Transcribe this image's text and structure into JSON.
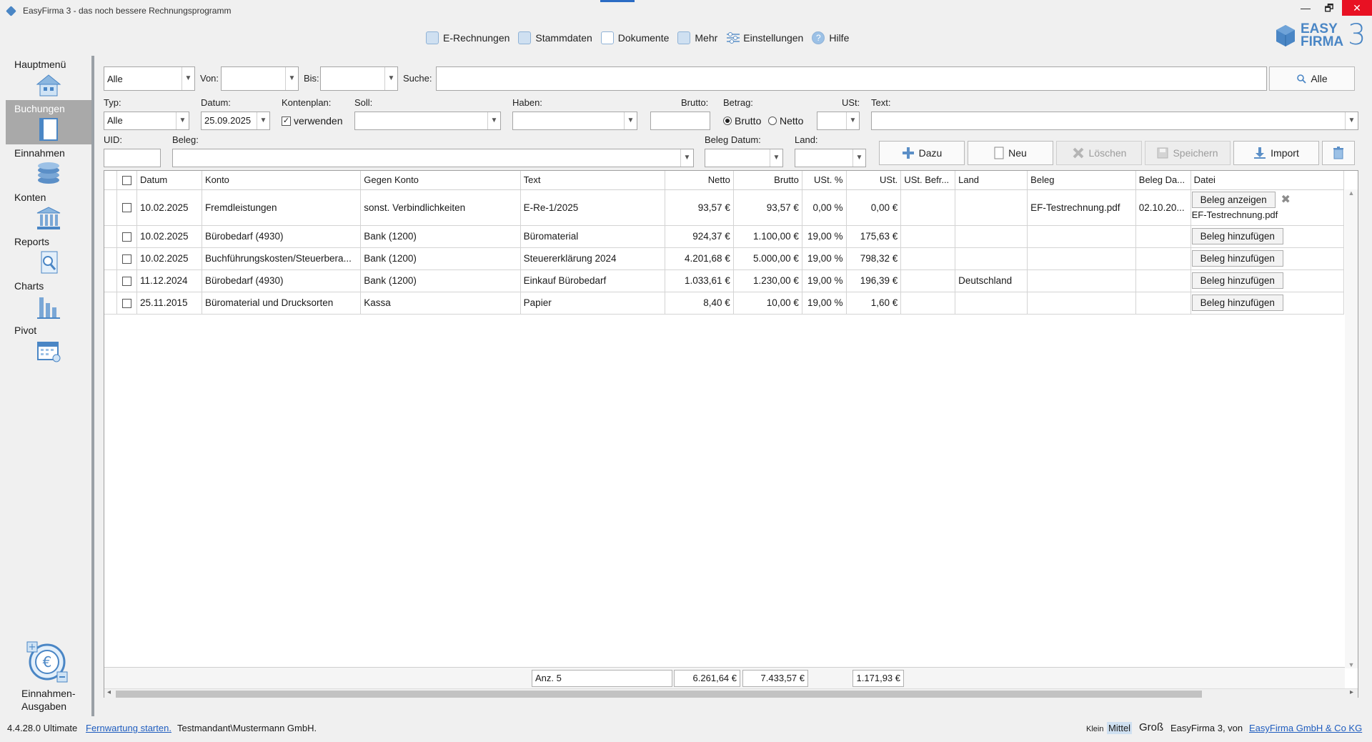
{
  "window": {
    "title": "EasyFirma 3 - das noch bessere Rechnungsprogramm",
    "minimize": "—",
    "restore": "🗗",
    "close": "✕"
  },
  "topnav": [
    {
      "label": "E-Rechnungen",
      "icon": "e-invoice-icon"
    },
    {
      "label": "Stammdaten",
      "icon": "master-data-icon"
    },
    {
      "label": "Dokumente",
      "icon": "documents-icon"
    },
    {
      "label": "Mehr",
      "icon": "more-icon"
    },
    {
      "label": "Einstellungen",
      "icon": "settings-icon"
    },
    {
      "label": "Hilfe",
      "icon": "help-icon"
    }
  ],
  "logo": {
    "line1": "EASY",
    "line2": "FIRMA",
    "number": "3"
  },
  "sidebar": {
    "items": [
      {
        "label": "Hauptmenü",
        "icon": "home-icon"
      },
      {
        "label": "Buchungen",
        "icon": "book-icon"
      },
      {
        "label": "Einnahmen",
        "icon": "coins-icon"
      },
      {
        "label": "Konten",
        "icon": "bank-icon"
      },
      {
        "label": "Reports",
        "icon": "report-search-icon"
      },
      {
        "label": "Charts",
        "icon": "bar-chart-icon"
      },
      {
        "label": "Pivot",
        "icon": "calendar-icon"
      }
    ],
    "bottom_label_1": "Einnahmen-",
    "bottom_label_2": "Ausgaben"
  },
  "filter": {
    "range_value": "Alle",
    "von_label": "Von:",
    "von_value": "",
    "bis_label": "Bis:",
    "bis_value": "",
    "suche_label": "Suche:",
    "suche_value": "",
    "search_button": "Alle"
  },
  "form": {
    "typ_label": "Typ:",
    "typ_value": "Alle",
    "datum_label": "Datum:",
    "datum_value": "25.09.2025",
    "kontenplan_label": "Kontenplan:",
    "kontenplan_checkbox": "verwenden",
    "soll_label": "Soll:",
    "haben_label": "Haben:",
    "brutto_label": "Brutto:",
    "betrag_label": "Betrag:",
    "radio_brutto": "Brutto",
    "radio_netto": "Netto",
    "ust_label": "USt:",
    "text_label": "Text:",
    "uid_label": "UID:",
    "beleg_label": "Beleg:",
    "beleg_datum_label": "Beleg Datum:",
    "land_label": "Land:"
  },
  "buttons": {
    "dazu": "Dazu",
    "neu": "Neu",
    "loeschen": "Löschen",
    "speichern": "Speichern",
    "import": "Import"
  },
  "table": {
    "headers": [
      "Datum",
      "Konto",
      "Gegen Konto",
      "Text",
      "Netto",
      "Brutto",
      "USt. %",
      "USt.",
      "USt. Befr...",
      "Land",
      "Beleg",
      "Beleg Da...",
      "Datei"
    ],
    "rows": [
      {
        "datum": "10.02.2025",
        "konto": "Fremdleistungen",
        "gegen": "sonst. Verbindlichkeiten",
        "text": "E-Re-1/2025",
        "netto": "93,57 €",
        "brutto": "93,57 €",
        "ustp": "0,00 %",
        "ust": "0,00 €",
        "befr": "",
        "land": "",
        "beleg": "EF-Testrechnung.pdf",
        "belegdatum": "02.10.20...",
        "datei_button": "Beleg anzeigen",
        "datei_name": "EF-Testrechnung.pdf"
      },
      {
        "datum": "10.02.2025",
        "konto": "Bürobedarf (4930)",
        "gegen": "Bank (1200)",
        "text": "Büromaterial",
        "netto": "924,37 €",
        "brutto": "1.100,00 €",
        "ustp": "19,00 %",
        "ust": "175,63 €",
        "befr": "",
        "land": "",
        "beleg": "",
        "belegdatum": "",
        "datei_button": "Beleg hinzufügen",
        "datei_name": ""
      },
      {
        "datum": "10.02.2025",
        "konto": "Buchführungskosten/Steuerbera...",
        "gegen": "Bank (1200)",
        "text": "Steuererklärung 2024",
        "netto": "4.201,68 €",
        "brutto": "5.000,00 €",
        "ustp": "19,00 %",
        "ust": "798,32 €",
        "befr": "",
        "land": "",
        "beleg": "",
        "belegdatum": "",
        "datei_button": "Beleg hinzufügen",
        "datei_name": ""
      },
      {
        "datum": "11.12.2024",
        "konto": "Bürobedarf (4930)",
        "gegen": "Bank (1200)",
        "text": "Einkauf Bürobedarf",
        "netto": "1.033,61 €",
        "brutto": "1.230,00 €",
        "ustp": "19,00 %",
        "ust": "196,39 €",
        "befr": "",
        "land": "Deutschland",
        "beleg": "",
        "belegdatum": "",
        "datei_button": "Beleg hinzufügen",
        "datei_name": ""
      },
      {
        "datum": "25.11.2015",
        "konto": "Büromaterial und Drucksorten",
        "gegen": "Kassa",
        "text": "Papier",
        "netto": "8,40 €",
        "brutto": "10,00 €",
        "ustp": "19,00 %",
        "ust": "1,60 €",
        "befr": "",
        "land": "",
        "beleg": "",
        "belegdatum": "",
        "datei_button": "Beleg hinzufügen",
        "datei_name": ""
      }
    ],
    "totals": {
      "count": "Anz. 5",
      "netto": "6.261,64 €",
      "brutto": "7.433,57 €",
      "ust": "1.171,93 €"
    }
  },
  "status": {
    "version": "4.4.28.0 Ultimate",
    "remote_link": "Fernwartung starten.",
    "tenant": "Testmandant\\Mustermann GmbH.",
    "size_small": "Klein",
    "size_medium": "Mittel",
    "size_large": "Groß",
    "credit": "EasyFirma 3, von",
    "company_link": "EasyFirma GmbH & Co KG"
  },
  "colors": {
    "accent": "#2b6cc4",
    "sidebar_active": "#a9a9a9",
    "close": "#e81123",
    "icon_blue": "#5b8fc7"
  }
}
